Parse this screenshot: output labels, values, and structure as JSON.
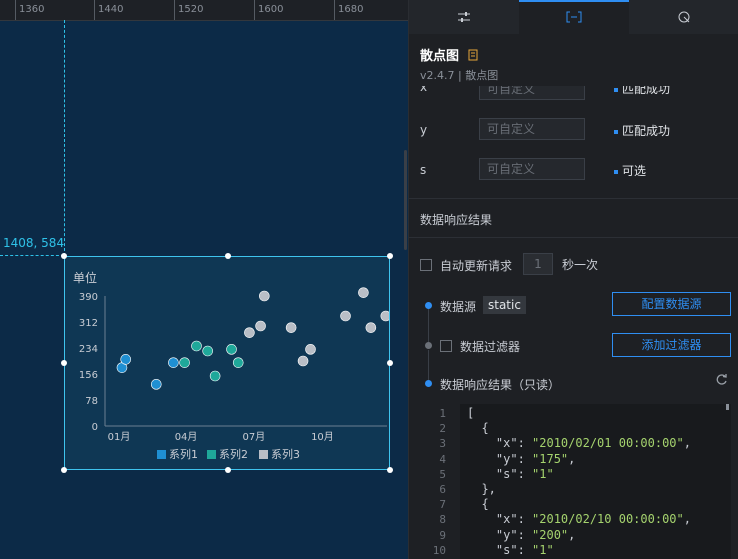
{
  "ruler": {
    "ticks": [
      "1360",
      "1440",
      "1520",
      "1600",
      "1680"
    ]
  },
  "canvas": {
    "coordinate": "1408, 584"
  },
  "chart": {
    "unit_label": "单位",
    "accent": "#3fc4ee",
    "legend": [
      "系列1",
      "系列2",
      "系列3"
    ],
    "colors": [
      "#1f8fd2",
      "#1fa89a",
      "#b9bec6"
    ]
  },
  "chart_data": {
    "type": "scatter",
    "ylabel": "单位",
    "ylim": [
      0,
      390
    ],
    "yticks": [
      "390",
      "312",
      "234",
      "156",
      "78",
      "0"
    ],
    "xticks": [
      "01月",
      "04月",
      "07月",
      "10月"
    ],
    "series": [
      {
        "name": "系列1",
        "points": [
          {
            "x": "2010/01/05",
            "y": 175
          },
          {
            "x": "2010/01/10",
            "y": 200
          },
          {
            "x": "2010/02/20",
            "y": 125
          },
          {
            "x": "2010/03/15",
            "y": 190
          }
        ]
      },
      {
        "name": "系列2",
        "points": [
          {
            "x": "2010/03/30",
            "y": 190
          },
          {
            "x": "2010/04/15",
            "y": 240
          },
          {
            "x": "2010/04/30",
            "y": 225
          },
          {
            "x": "2010/05/10",
            "y": 150
          },
          {
            "x": "2010/06/01",
            "y": 230
          },
          {
            "x": "2010/06/10",
            "y": 190
          }
        ]
      },
      {
        "name": "系列3",
        "points": [
          {
            "x": "2010/06/25",
            "y": 280
          },
          {
            "x": "2010/07/10",
            "y": 300
          },
          {
            "x": "2010/07/15",
            "y": 390
          },
          {
            "x": "2010/08/20",
            "y": 295
          },
          {
            "x": "2010/09/05",
            "y": 195
          },
          {
            "x": "2010/09/15",
            "y": 230
          },
          {
            "x": "2010/11/01",
            "y": 330
          },
          {
            "x": "2010/11/25",
            "y": 400
          },
          {
            "x": "2010/12/05",
            "y": 295
          },
          {
            "x": "2010/12/25",
            "y": 330
          }
        ]
      }
    ]
  },
  "tabs": [
    "settings-sliders-icon",
    "data-bracket-icon",
    "interaction-icon"
  ],
  "component": {
    "title": "散点图",
    "subtitle": "v2.4.7 | 散点图"
  },
  "fields": {
    "x": {
      "label": "x",
      "placeholder": "可自定义",
      "status": "匹配成功"
    },
    "y": {
      "label": "y",
      "placeholder": "可自定义",
      "status": "匹配成功"
    },
    "s": {
      "label": "s",
      "placeholder": "可自定义",
      "status": "可选"
    }
  },
  "data_section": {
    "title": "数据响应结果",
    "auto_update_label": "自动更新请求",
    "interval_value": "1",
    "interval_unit": "秒一次",
    "source_label": "数据源",
    "source_value": "static",
    "config_button": "配置数据源",
    "filter_label": "数据过滤器",
    "filter_button": "添加过滤器",
    "result_label": "数据响应结果（只读）"
  },
  "code": {
    "line_numbers": [
      "1",
      "2",
      "3",
      "4",
      "5",
      "6",
      "7",
      "8",
      "9",
      "10"
    ],
    "lines": [
      "[",
      "  {",
      "    \"x\": \"2010/02/01 00:00:00\",",
      "    \"y\": \"175\",",
      "    \"s\": \"1\"",
      "  },",
      "  {",
      "    \"x\": \"2010/02/10 00:00:00\",",
      "    \"y\": \"200\",",
      "    \"s\": \"1\""
    ]
  }
}
